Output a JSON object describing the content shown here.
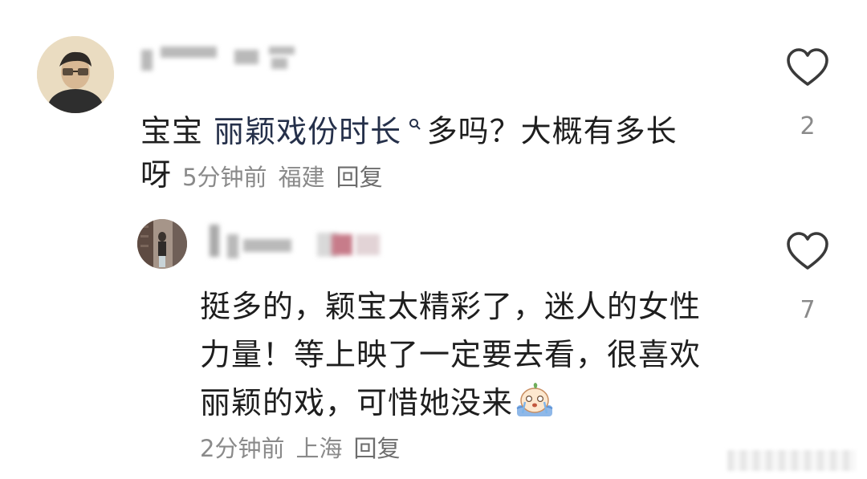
{
  "comments": [
    {
      "text_mention_prefix": "宝宝 ",
      "mention": "丽颖戏份时长",
      "text_rest": " 多吗？大概有多长",
      "text_wrap": "呀",
      "time": "5分钟前",
      "location": "福建",
      "reply": "回复",
      "likes": "2",
      "avatar_icon": "user-avatar-icon",
      "like_icon": "heart-outline-icon"
    },
    {
      "line1": "挺多的，颖宝太精彩了，迷人的女性",
      "line2": "力量！等上映了一定要去看，很喜欢",
      "line3": "丽颖的戏，可惜她没来",
      "time": "2分钟前",
      "location": "上海",
      "reply": "回复",
      "likes": "7",
      "avatar_icon": "user-avatar-icon",
      "like_icon": "heart-outline-icon",
      "emoji_icon": "crying-emoji-icon"
    }
  ],
  "colors": {
    "text": "#1e1e1e",
    "meta": "#8a8a8a",
    "mention": "#25304a",
    "heart_outline": "#3a3a3a"
  }
}
